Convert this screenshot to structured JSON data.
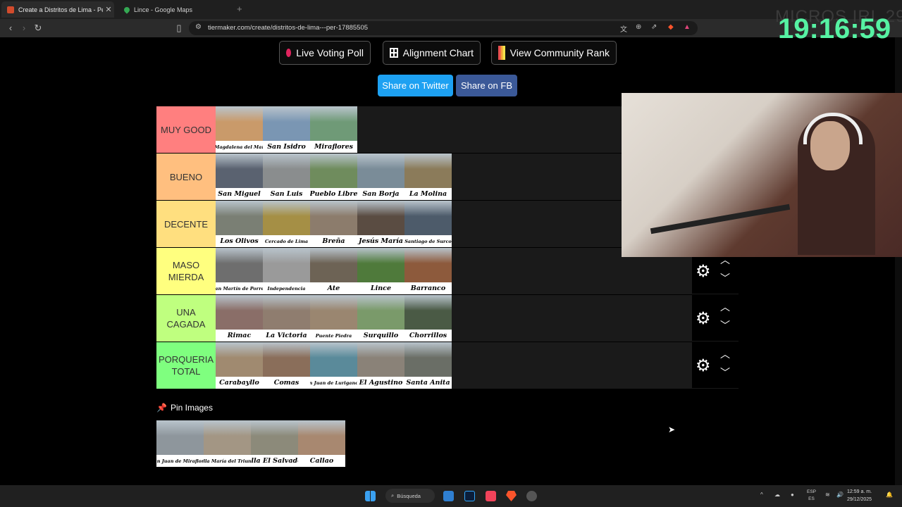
{
  "browser": {
    "tabs": [
      {
        "title": "Create a Distritos de Lima - Peru",
        "favicon_color": "#d24b2c"
      },
      {
        "title": "Lince - Google Maps",
        "favicon_color": "#34a853"
      }
    ],
    "new_tab": "+",
    "url": "tiermaker.com/create/distritos-de-lima---per-17885505"
  },
  "overlay": {
    "watermark": "MICROS IRL 29",
    "clock": "19:16:59"
  },
  "header_buttons": {
    "live_voting": "Live Voting Poll",
    "alignment": "Alignment Chart",
    "community_rank": "View Community Rank"
  },
  "share": {
    "twitter": "Share on Twitter",
    "fb": "Share on FB"
  },
  "tiers": [
    {
      "label": "MUY GOOD",
      "color": "#ff7f7f",
      "items": [
        {
          "name": "Magdalena del Mar",
          "small": true,
          "color": "#c99a6a"
        },
        {
          "name": "San Isidro",
          "color": "#7a96b3"
        },
        {
          "name": "Miraflores",
          "color": "#6f9a77"
        }
      ]
    },
    {
      "label": "BUENO",
      "color": "#ffbf7f",
      "items": [
        {
          "name": "San Miguel",
          "color": "#5a6270"
        },
        {
          "name": "San Luis",
          "color": "#8a8d8e"
        },
        {
          "name": "Pueblo Libre",
          "color": "#6f8c5d"
        },
        {
          "name": "San Borja",
          "color": "#7a8c98"
        },
        {
          "name": "La Molina",
          "color": "#8b7b5a"
        }
      ]
    },
    {
      "label": "DECENTE",
      "color": "#ffdf7f",
      "items": [
        {
          "name": "Los Olivos",
          "color": "#7a7f74"
        },
        {
          "name": "Cercado de Lima",
          "small": true,
          "color": "#a58f45"
        },
        {
          "name": "Breña",
          "color": "#8c7c6c"
        },
        {
          "name": "Jesús María",
          "color": "#5a4c42"
        },
        {
          "name": "Santiago de Surco",
          "small": true,
          "color": "#4d5b6a"
        }
      ]
    },
    {
      "label": "MASO MIERDA",
      "color": "#ffff7f",
      "items": [
        {
          "name": "San Martín de Porres",
          "small": true,
          "color": "#6e6e6e"
        },
        {
          "name": "Independencia",
          "small": true,
          "color": "#9a9a9a"
        },
        {
          "name": "Ate",
          "color": "#6d6355"
        },
        {
          "name": "Lince",
          "color": "#4f7a3b"
        },
        {
          "name": "Barranco",
          "color": "#8d5a3c"
        }
      ]
    },
    {
      "label": "UNA CAGADA",
      "color": "#bfff7f",
      "items": [
        {
          "name": "Rimac",
          "color": "#8a6e68"
        },
        {
          "name": "La Victoria",
          "color": "#8f7d6f"
        },
        {
          "name": "Puente Piedra",
          "small": true,
          "color": "#9a8670"
        },
        {
          "name": "Surquillo",
          "color": "#7a9a6a"
        },
        {
          "name": "Chorrillos",
          "color": "#4a5a45"
        }
      ]
    },
    {
      "label": "PORQUERIA TOTAL",
      "color": "#7fff7f",
      "items": [
        {
          "name": "Carabayllo",
          "color": "#a08a70"
        },
        {
          "name": "Comas",
          "color": "#8a6e5a"
        },
        {
          "name": "San Juan de Lurigancho",
          "small": true,
          "color": "#5a8a9a"
        },
        {
          "name": "El Agustino",
          "color": "#8a8278"
        },
        {
          "name": "Santa Anita",
          "color": "#6a6e66"
        }
      ]
    }
  ],
  "pin": {
    "label": "Pin Images",
    "items": [
      {
        "name": "San Juan de Miraflores",
        "small": true,
        "color": "#8e969c"
      },
      {
        "name": "Villa María del Triunfo",
        "small": true,
        "color": "#a39684"
      },
      {
        "name": "Villa El Salvador",
        "color": "#8c8a7a"
      },
      {
        "name": "Callao",
        "color": "#a88870"
      }
    ]
  },
  "taskbar": {
    "search": "Búsqueda",
    "lang_top": "ESP",
    "lang_bottom": "ES",
    "time": "12:59 a. m.",
    "date": "29/12/2025"
  }
}
